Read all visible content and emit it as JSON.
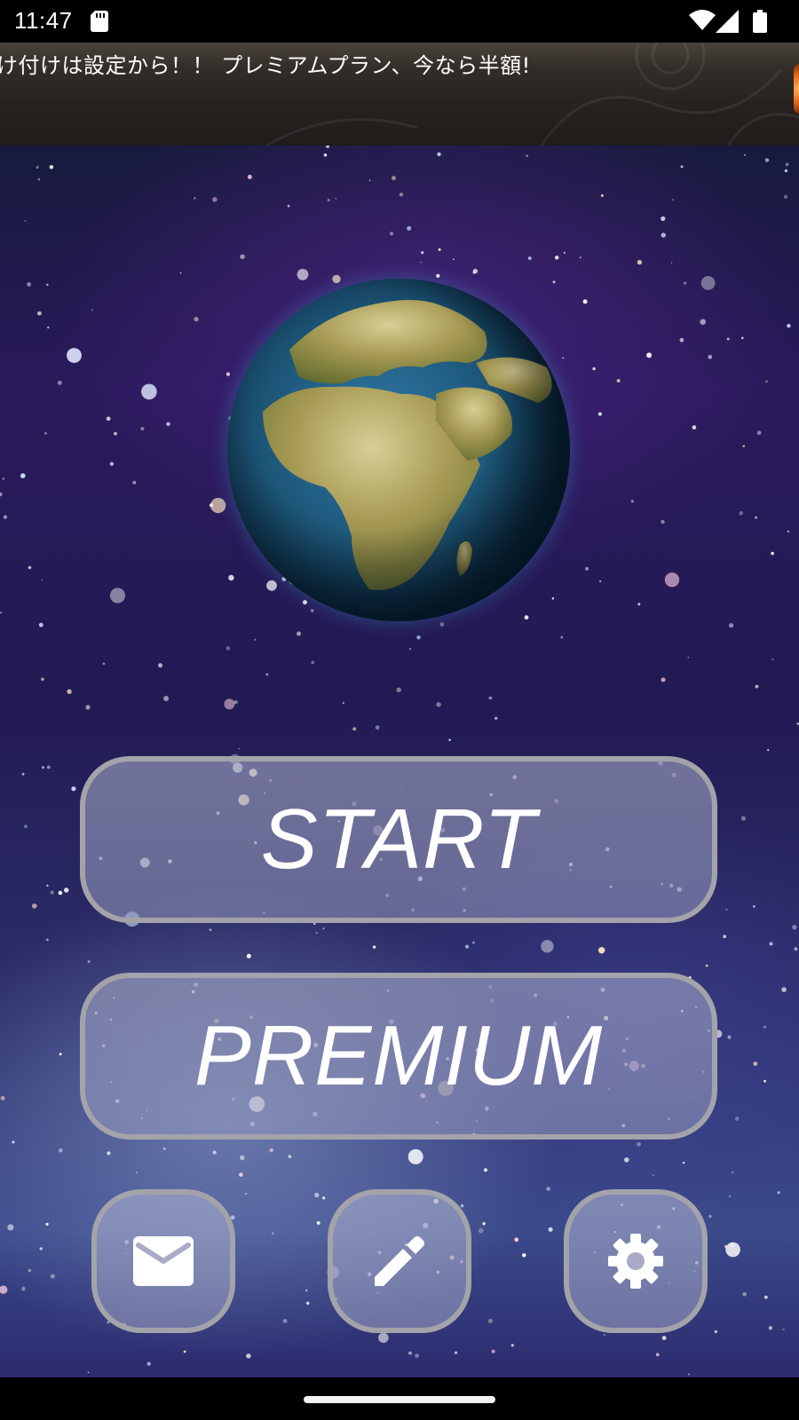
{
  "status_bar": {
    "time": "11:47",
    "icons": [
      "sd-card-icon",
      "wifi-icon",
      "cell-signal-icon",
      "battery-icon"
    ]
  },
  "banner": {
    "text": "け付けは設定から！！ プレミアムプラン、今なら半額!"
  },
  "main_menu": {
    "start_label": "START",
    "premium_label": "PREMIUM",
    "small_buttons": [
      "mail-icon",
      "pencil-icon",
      "gear-icon"
    ]
  },
  "colors": {
    "button_border": "#a3a3aa",
    "button_fill": "#9da2c0",
    "space_top": "#171a3d",
    "space_bottom": "#3a4a8a",
    "banner_bg": "#2a2623"
  }
}
